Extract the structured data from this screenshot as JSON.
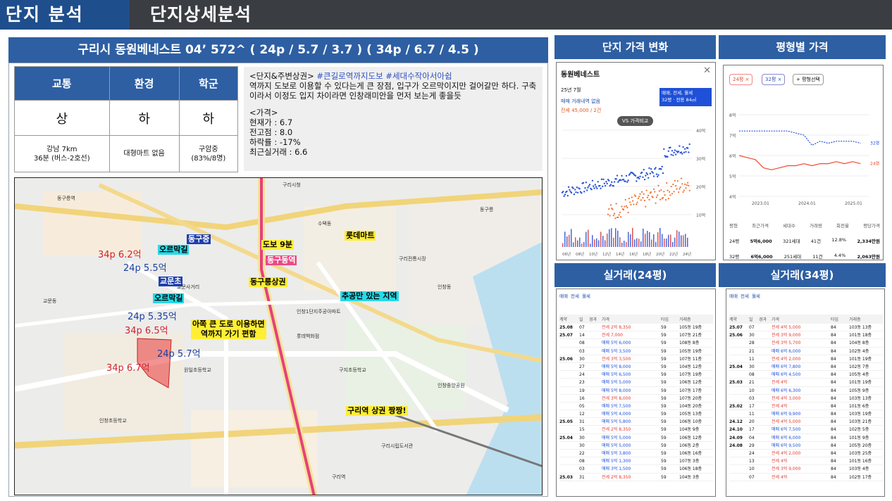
{
  "header": {
    "section": "단지 분석",
    "title": "단지상세분석"
  },
  "complex": {
    "title": "구리시 동원베네스트 04’ 572^ ( 24p / 5.7 / 3.7 ) ( 34p / 6.7 / 4.5 )",
    "categories": [
      "교통",
      "환경",
      "학군"
    ],
    "grades": [
      "상",
      "하",
      "하"
    ],
    "notes": [
      "강남 7km\n36분 (버스-2호선)",
      "대형마트 없음",
      "구암중\n(83%/8명)"
    ],
    "desc_heading": "<단지&주변상권>",
    "desc_tags": "#큰길로역까지도보 #세대수작아서아쉽",
    "desc_body": "역까지 도보로 이용할 수 있다는게 큰 장점, 입구가 오르막이지만 걸어갈만 하다. 구축이라서 이정도 입지 차이라면 인창래미안을 먼저 보는게 좋을듯",
    "price_heading": "<가격>",
    "prices": [
      "현재가 : 6.7",
      "전고점 : 8.0",
      "하락률 : -17%",
      "최근실거래 : 6.6"
    ]
  },
  "map": {
    "labels": [
      {
        "text": "동구중",
        "style": "bl"
      },
      {
        "text": "오르막길",
        "style": "cy"
      },
      {
        "text": "도보 9분",
        "style": "yl"
      },
      {
        "text": "롯데마트",
        "style": "yl"
      },
      {
        "text": "동구동역",
        "style": "pk"
      },
      {
        "text": "교문초",
        "style": "bl"
      },
      {
        "text": "오르막길",
        "style": "cy"
      },
      {
        "text": "동구릉상권",
        "style": "yl"
      },
      {
        "text": "추공만 있는 지역",
        "style": "cy"
      },
      {
        "text": "아쪽 큰 도로 이용하면\n역까지 가기 편함",
        "style": "yl"
      },
      {
        "text": "구리역 상권 짱짱!",
        "style": "yl"
      }
    ],
    "prices": [
      {
        "text": "34p 6.2억",
        "color": "r"
      },
      {
        "text": "24p 5.5억",
        "color": "b"
      },
      {
        "text": "24p 5.35억",
        "color": "b"
      },
      {
        "text": "34p 6.5억",
        "color": "r"
      },
      {
        "text": "24p 5.7억",
        "color": "b"
      },
      {
        "text": "34p 6.7억",
        "color": "r"
      }
    ],
    "places": [
      "구리시청",
      "동구릉역",
      "구리역",
      "인창동",
      "교문동",
      "수택동",
      "인창중앙공원",
      "구리전통시장",
      "동구릉",
      "교문사거리",
      "구리시립도서관",
      "롯데백화점",
      "인창1단지주공아파트",
      "원일초등학교",
      "구지초등학교",
      "인창초등학교"
    ]
  },
  "right": {
    "heads": [
      "단지 가격 변화",
      "평형별 가격",
      "실거래(24평)",
      "실거래(34평)"
    ],
    "chart1": {
      "name": "동원베네스트",
      "date": "25년 7월",
      "no_trade": "매매 거래내역 없음",
      "jeonse": "전세 45,000 / 2건",
      "filter": "매매, 전세, 월세",
      "size": "32평 · 전용 84㎡",
      "vs": "VS 가격비교",
      "years": [
        "06년",
        "08년",
        "10년",
        "12년",
        "14년",
        "16년",
        "18년",
        "20년",
        "22년",
        "24년"
      ],
      "yaxis": [
        "40억",
        "30억",
        "20억",
        "10억"
      ]
    },
    "chart2": {
      "chips": [
        "24평 ×",
        "32평 ×",
        "+ 평형선택"
      ],
      "yaxis": [
        "8억",
        "7억",
        "6억",
        "5억",
        "4억"
      ],
      "xaxis": [
        "2023.01",
        "2024.01",
        "2025.01"
      ],
      "legend": [
        "32평",
        "24평"
      ],
      "table_head": [
        "평형",
        "최근가격",
        "세대수",
        "거래량",
        "회전율",
        "평당가격"
      ],
      "rows": [
        [
          "24평",
          "5억6,000",
          "321세대",
          "41건",
          "12.8%",
          "2,334만원"
        ],
        [
          "32평",
          "6억6,000",
          "251세대",
          "11건",
          "4.4%",
          "2,063만원"
        ]
      ]
    },
    "t24": {
      "tabs": [
        "매매",
        "전세",
        "월세"
      ],
      "col": [
        "계약",
        "일",
        "경과",
        "가격",
        "타입",
        "거래층"
      ],
      "rows": [
        [
          "25.08",
          "07",
          "전세 2억 8,350",
          "59",
          "105동 19층"
        ],
        [
          "25.07",
          "14",
          "전세 7,000",
          "59",
          "107동 21층"
        ],
        [
          "",
          "08",
          "매매 5억 6,000",
          "59",
          "108동 8층"
        ],
        [
          "",
          "03",
          "매매 5억 3,500",
          "59",
          "105동 19층"
        ],
        [
          "25.06",
          "30",
          "전세 3억 3,500",
          "59",
          "107동 11층"
        ],
        [
          "",
          "27",
          "매매 5억 8,000",
          "59",
          "104동 12층"
        ],
        [
          "",
          "24",
          "매매 5억 6,500",
          "59",
          "107동 19층"
        ],
        [
          "",
          "23",
          "매매 5억 5,000",
          "59",
          "106동 12층"
        ],
        [
          "",
          "19",
          "매매 5억 8,000",
          "59",
          "107동 17층"
        ],
        [
          "",
          "16",
          "전세 3억 8,000",
          "59",
          "107동 20층"
        ],
        [
          "",
          "05",
          "매매 5억 7,500",
          "59",
          "104동 20층"
        ],
        [
          "",
          "12",
          "매매 5억 4,000",
          "59",
          "105동 13층"
        ],
        [
          "25.05",
          "31",
          "매매 5억 5,800",
          "59",
          "106동 10층"
        ],
        [
          "",
          "15",
          "전세 2억 8,350",
          "59",
          "104동 9층"
        ],
        [
          "25.04",
          "30",
          "매매 5억 5,000",
          "59",
          "106동 12층"
        ],
        [
          "",
          "30",
          "매매 5억 5,000",
          "59",
          "106동 2층"
        ],
        [
          "",
          "22",
          "매매 5억 3,800",
          "59",
          "106동 16층"
        ],
        [
          "",
          "08",
          "매매 5억 1,300",
          "59",
          "107동 3층"
        ],
        [
          "",
          "03",
          "매매 3억 1,500",
          "59",
          "106동 18층"
        ],
        [
          "25.03",
          "31",
          "전세 2억 8,350",
          "59",
          "104동 3층"
        ]
      ]
    },
    "t34": {
      "rows": [
        [
          "25.07",
          "07",
          "전세 4억 5,000",
          "84",
          "103동 13층"
        ],
        [
          "25.06",
          "30",
          "전세 3억 9,000",
          "84",
          "101동 18층"
        ],
        [
          "",
          "28",
          "전세 3억 5,700",
          "84",
          "104동 8층"
        ],
        [
          "",
          "21",
          "매매 6억 6,000",
          "84",
          "102동 4층"
        ],
        [
          "",
          "11",
          "전세 4억 2,000",
          "84",
          "101동 19층"
        ],
        [
          "25.04",
          "30",
          "매매 6억 7,800",
          "84",
          "102동 7층"
        ],
        [
          "",
          "08",
          "매매 6억 4,500",
          "84",
          "105동 4층"
        ],
        [
          "25.03",
          "21",
          "전세 4억",
          "84",
          "101동 19층"
        ],
        [
          "",
          "10",
          "매매 6억 6,300",
          "84",
          "105동 9층"
        ],
        [
          "",
          "03",
          "전세 4억 3,000",
          "84",
          "103동 13층"
        ],
        [
          "25.02",
          "17",
          "전세 4억",
          "84",
          "101동 6층"
        ],
        [
          "",
          "11",
          "매매 6억 9,900",
          "84",
          "103동 19층"
        ],
        [
          "24.12",
          "20",
          "전세 4억 5,000",
          "84",
          "103동 21층"
        ],
        [
          "24.10",
          "17",
          "매매 6억 7,500",
          "84",
          "102동 5층"
        ],
        [
          "24.09",
          "04",
          "매매 6억 6,000",
          "84",
          "101동 9층"
        ],
        [
          "24.08",
          "29",
          "매매 6억 9,500",
          "84",
          "105동 20층"
        ],
        [
          "",
          "24",
          "전세 4억 2,000",
          "84",
          "103동 25층"
        ],
        [
          "",
          "13",
          "전세 4억",
          "84",
          "101동 16층"
        ],
        [
          "",
          "10",
          "전세 3억 9,000",
          "84",
          "103동 4층"
        ],
        [
          "",
          "07",
          "전세 4억",
          "84",
          "102동 17층"
        ]
      ]
    }
  }
}
